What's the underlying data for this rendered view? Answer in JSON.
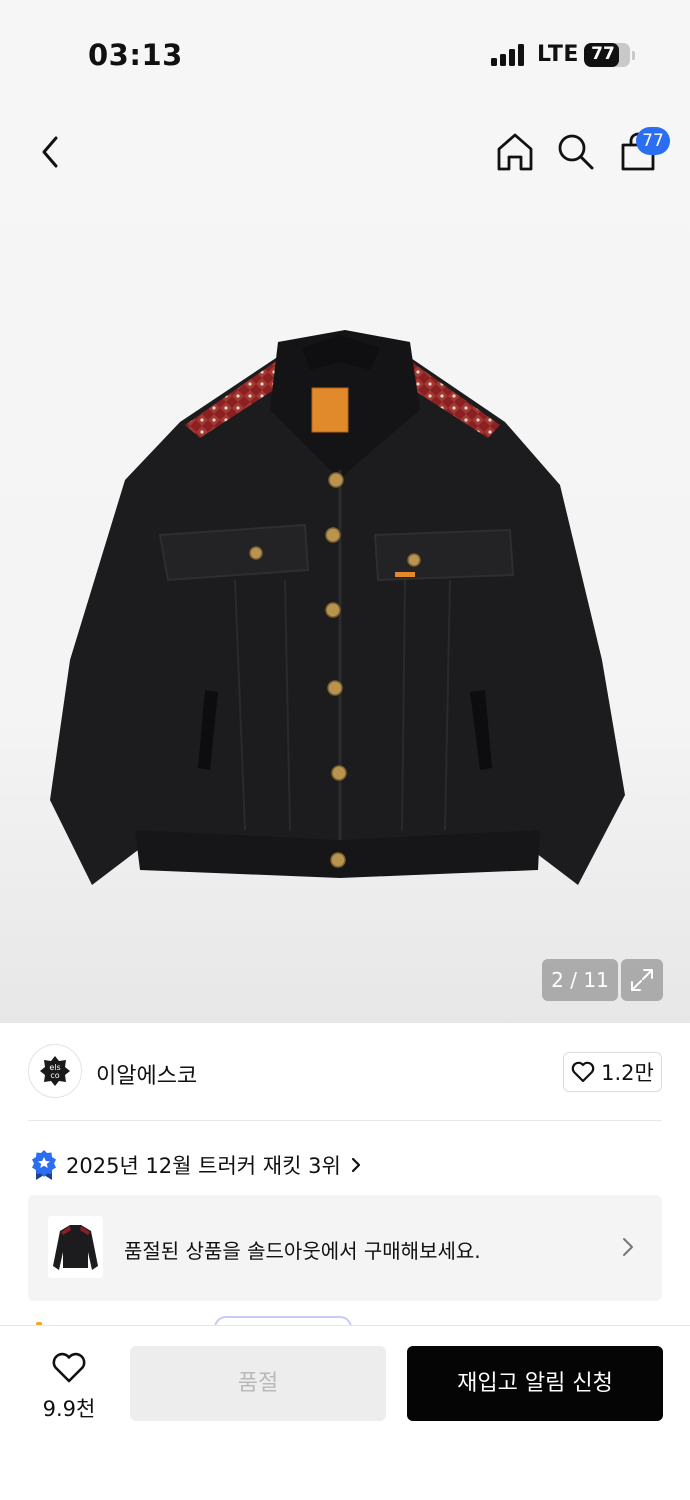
{
  "status_bar": {
    "time": "03:13",
    "network": "LTE",
    "battery": "77",
    "battery_level": 0.77
  },
  "header": {
    "cart_badge": "77",
    "icons": [
      "back-icon",
      "home-icon",
      "search-icon",
      "shopping-bag-icon"
    ]
  },
  "gallery": {
    "current": 2,
    "total": 11,
    "counter": "2 / 11",
    "image": "black denim trucker jacket with red patterned shoulder panel"
  },
  "brand": {
    "name": "이알에스코",
    "logo_text": "els co",
    "likes": "1.2만"
  },
  "ranking": {
    "text": "2025년 12월 트러커 재킷 3위"
  },
  "soldout_notice": {
    "text": "품절된 상품을 솔드아웃에서 구매해보세요."
  },
  "bottom_bar": {
    "wish_count": "9.9천",
    "soldout_label": "품절",
    "restock_label": "재입고 알림 신청"
  },
  "colors": {
    "accent_blue": "#2b6ef2",
    "primary_black": "#050505",
    "disabled_bg": "#ededed"
  }
}
